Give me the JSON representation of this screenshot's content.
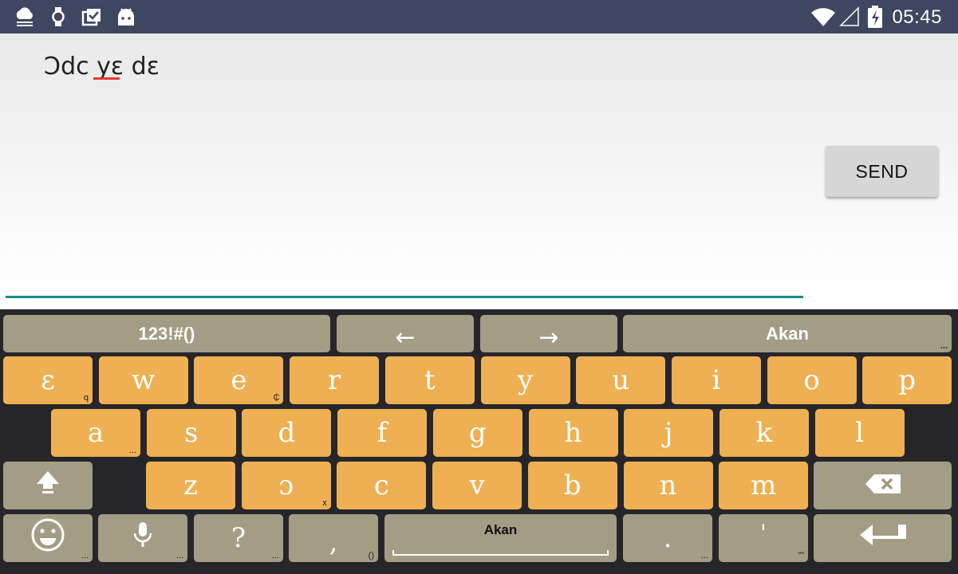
{
  "status_bar": {
    "time": "05:45",
    "left_icons": [
      "cloud-weather-icon",
      "watch-icon",
      "checklist-icon",
      "android-icon"
    ],
    "right_icons": [
      "wifi-icon",
      "cell-signal-icon",
      "battery-charging-icon"
    ]
  },
  "compose": {
    "message_text": "Ɔdc yɛ dɛ",
    "send_label": "SEND"
  },
  "keyboard": {
    "layout_name": "Akan",
    "top_row": {
      "symbols_label": "123!#()",
      "left_arrow_label": "←",
      "right_arrow_label": "→",
      "language_label": "Akan",
      "language_hint": "..."
    },
    "row1": [
      {
        "label": "ɛ",
        "hint": "q"
      },
      {
        "label": "w",
        "hint": ""
      },
      {
        "label": "e",
        "hint": "₵"
      },
      {
        "label": "r",
        "hint": ""
      },
      {
        "label": "t",
        "hint": ""
      },
      {
        "label": "y",
        "hint": ""
      },
      {
        "label": "u",
        "hint": ""
      },
      {
        "label": "i",
        "hint": ""
      },
      {
        "label": "o",
        "hint": ""
      },
      {
        "label": "p",
        "hint": ""
      }
    ],
    "row2": [
      {
        "label": "a",
        "hint": "..."
      },
      {
        "label": "s",
        "hint": ""
      },
      {
        "label": "d",
        "hint": ""
      },
      {
        "label": "f",
        "hint": ""
      },
      {
        "label": "g",
        "hint": ""
      },
      {
        "label": "h",
        "hint": ""
      },
      {
        "label": "j",
        "hint": ""
      },
      {
        "label": "k",
        "hint": ""
      },
      {
        "label": "l",
        "hint": ""
      }
    ],
    "row3": [
      {
        "label": "z",
        "hint": ""
      },
      {
        "label": "ɔ",
        "hint": "x"
      },
      {
        "label": "c",
        "hint": ""
      },
      {
        "label": "v",
        "hint": ""
      },
      {
        "label": "b",
        "hint": ""
      },
      {
        "label": "n",
        "hint": ""
      },
      {
        "label": "m",
        "hint": ""
      }
    ],
    "bottom_row": {
      "emoji_hint": "...",
      "mic_hint": "...",
      "question_label": "?",
      "question_hint": "...",
      "comma_label": ",",
      "comma_hint": "()",
      "space_label": "Akan",
      "period_label": ".",
      "period_hint": "...",
      "apostrophe_label": "'",
      "apostrophe_hint": "\"\""
    }
  }
}
